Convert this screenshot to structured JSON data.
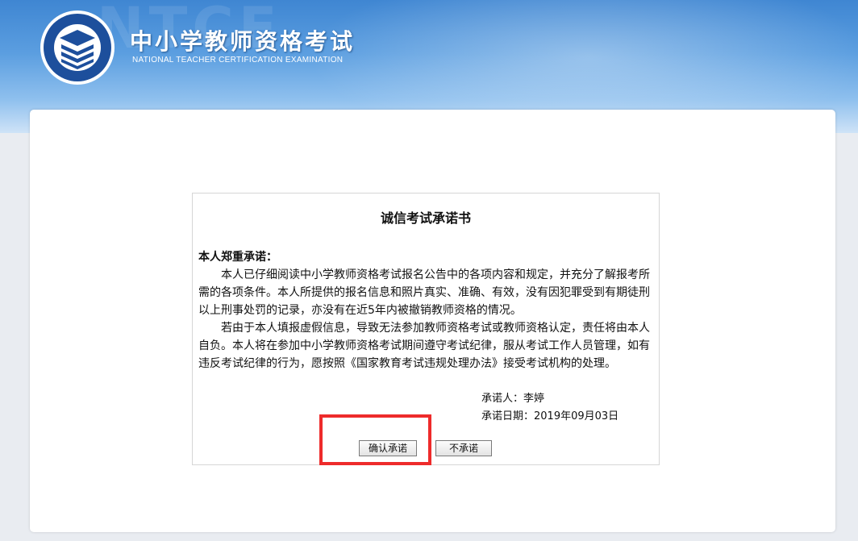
{
  "header": {
    "title_zh": "中小学教师资格考试",
    "title_en": "NATIONAL TEACHER CERTIFICATION EXAMINATION",
    "logo_icon": "book-seal-logo-icon"
  },
  "pledge": {
    "title": "诚信考试承诺书",
    "lead": "本人郑重承诺：",
    "paragraph1": "本人已仔细阅读中小学教师资格考试报名公告中的各项内容和规定，并充分了解报考所需的各项条件。本人所提供的报名信息和照片真实、准确、有效，没有因犯罪受到有期徒刑以上刑事处罚的记录，亦没有在近5年内被撤销教师资格的情况。",
    "paragraph2": "若由于本人填报虚假信息，导致无法参加教师资格考试或教师资格认定，责任将由本人自负。本人将在参加中小学教师资格考试期间遵守考试纪律，服从考试工作人员管理，如有违反考试纪律的行为，愿按照《国家教育考试违规处理办法》接受考试机构的处理。",
    "signer": "承诺人：李婷",
    "date": "承诺日期：2019年09月03日"
  },
  "buttons": {
    "confirm_label": "确认承诺",
    "decline_label": "不承诺"
  },
  "colors": {
    "header_blue": "#3f86d2",
    "highlight_red": "#ee2b2b"
  }
}
